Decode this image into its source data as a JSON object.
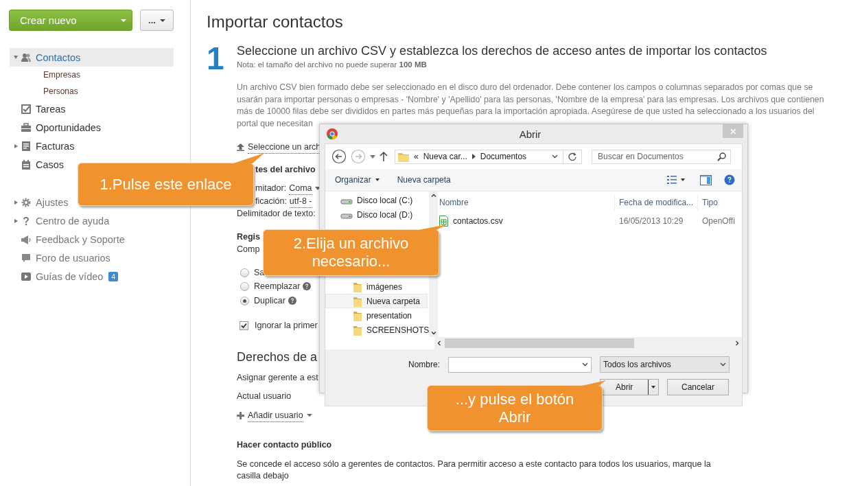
{
  "sidebar": {
    "create_button": "Crear nuevo",
    "more_button": "...",
    "nav": [
      {
        "label": "Contactos",
        "kind": "folder",
        "expanded": true,
        "selected": true,
        "children": [
          {
            "label": "Empresas",
            "selected": false
          },
          {
            "label": "Personas",
            "selected": false
          }
        ]
      },
      {
        "label": "Tareas",
        "kind": "item",
        "selected": false
      },
      {
        "label": "Oportunidades",
        "kind": "item",
        "selected": false
      },
      {
        "label": "Facturas",
        "kind": "folder",
        "expanded": false,
        "selected": false
      },
      {
        "label": "Casos",
        "kind": "item",
        "selected": false
      }
    ],
    "help_nav": [
      {
        "label": "Ajustes",
        "kind": "folder",
        "expanded": false
      },
      {
        "label": "Centro de ayuda",
        "kind": "folder",
        "expanded": false
      },
      {
        "label": "Feedback y Soporte",
        "kind": "item"
      },
      {
        "label": "Foro de usuarios",
        "kind": "item"
      },
      {
        "label": "Guías de vídeo",
        "kind": "item",
        "badge": "4"
      }
    ]
  },
  "main": {
    "title": "Importar contactos",
    "step_number": "1",
    "step_heading": "Seleccione un archivo CSV y establezca los derechos de acceso antes de importar los contactos",
    "note": "Nota: el tamaño del archivo no puede superar **100 MB**",
    "description_lines": [
      "Un archivo CSV bien formado debe ser seleccionado en el disco duro del ordenador. Debe contener los campos o columnas separados por comas que se",
      "usarán para importar personas o empresas - 'Nombre' y 'Apellido' para las personas, 'Nombre de la empresa' para las empresas. Los archivos que contienen",
      "más de 10000 filas debe ser divididos en partes más pequeñas para la importación apropiada. Asegúrese de que usted ha seleccionado a los usuarios del",
      "portal que necesitan"
    ],
    "select_link": "Seleccione un arch",
    "file_parts_heading": "tes del archivo",
    "settings": [
      {
        "label": "mitador:",
        "value": "Coma",
        "dropdown": true
      },
      {
        "label": "ficación:",
        "value": "utf-8 -",
        "dropdown": false
      },
      {
        "label": "Delimitador de texto:"
      }
    ],
    "records_heading": "Regis",
    "records_text": "Comp",
    "options": [
      {
        "label": "Sa",
        "selected": false,
        "help": false
      },
      {
        "label": "Reemplazar",
        "selected": false,
        "help": true
      },
      {
        "label": "Duplicar",
        "selected": true,
        "help": true
      }
    ],
    "ignore_checkbox": {
      "label": "Ignorar la primer",
      "checked": true
    },
    "rights_heading": "Derechos de a",
    "assign_text": "Asignar gerente a est",
    "current_user": "Actual usuario",
    "add_user_link": "Añadir usuario",
    "public_heading": "Hacer contacto público",
    "public_text": "Se concede el acceso sólo a gerentes de contactos. Para permitir acceso a este contacto para todos los usuarios, marque la casilla debajo"
  },
  "dialog": {
    "title": "Abrir",
    "breadcrumb": [
      "«",
      "Nueva car...",
      "Documentos"
    ],
    "search_placeholder": "Buscar en Documentos",
    "toolbar": [
      "Organizar",
      "Nueva carpeta"
    ],
    "tree": [
      {
        "label": "Disco local (C:)",
        "kind": "drive",
        "selected": false
      },
      {
        "label": "Disco local (D:)",
        "kind": "drive",
        "selected": false
      },
      {
        "label": "imágenes",
        "kind": "folder",
        "selected": false
      },
      {
        "label": "Nueva carpeta",
        "kind": "folder",
        "selected": true
      },
      {
        "label": "presentation",
        "kind": "folder",
        "selected": false
      },
      {
        "label": "SCREENSHOTS",
        "kind": "folder",
        "selected": false
      }
    ],
    "columns": [
      "Nombre",
      "Fecha de modifica...",
      "Tipo"
    ],
    "files": [
      {
        "name": "contactos.csv",
        "date": "16/05/2013 10:29",
        "type": "OpenOffi"
      }
    ],
    "name_label": "Nombre:",
    "file_type": "Todos los archivos",
    "open_button": "Abrir",
    "cancel_button": "Cancelar"
  },
  "callouts": [
    {
      "text": "1.Pulse este enlace"
    },
    {
      "text": "2.Elija un archivo necesario..."
    },
    {
      "text": "...y pulse el botón Abrir"
    }
  ]
}
